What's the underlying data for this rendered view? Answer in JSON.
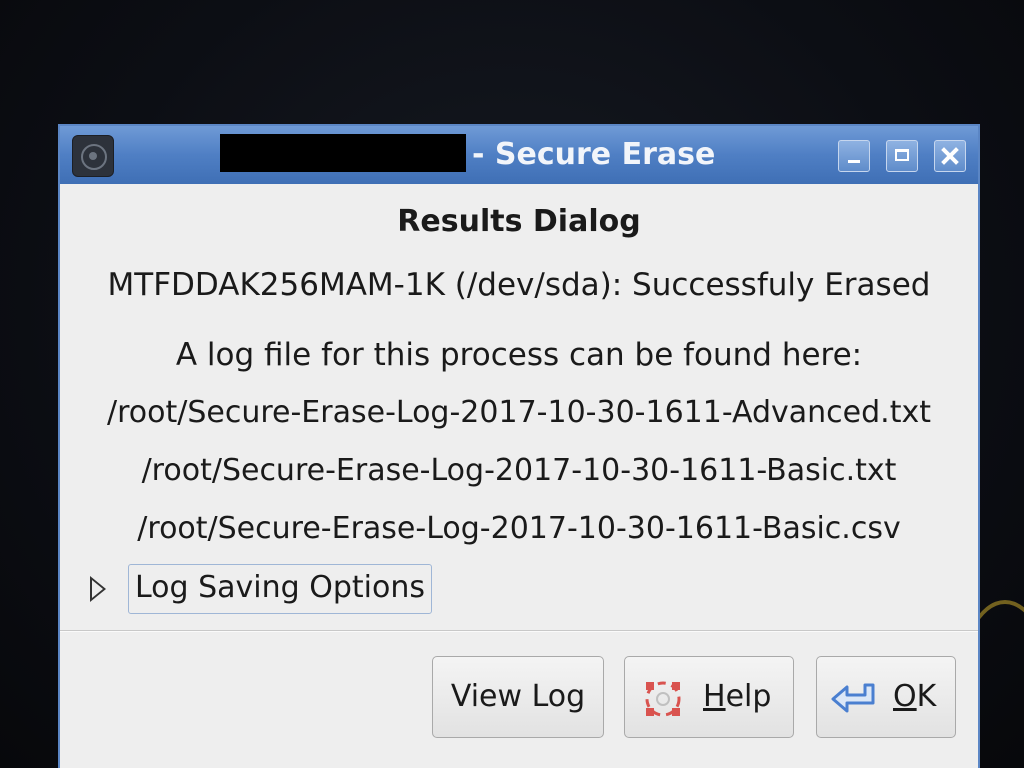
{
  "window": {
    "title_suffix": "- Secure Erase"
  },
  "dialog": {
    "heading": "Results Dialog",
    "status_line": "MTFDDAK256MAM-1K (/dev/sda): Successfuly Erased",
    "log_intro": "A log file for this process can be found here:",
    "log_paths": [
      "/root/Secure-Erase-Log-2017-10-30-1611-Advanced.txt",
      "/root/Secure-Erase-Log-2017-10-30-1611-Basic.txt",
      "/root/Secure-Erase-Log-2017-10-30-1611-Basic.csv"
    ],
    "expander_label": "Log Saving Options"
  },
  "buttons": {
    "view_log": "View Log",
    "help_mnemonic": "H",
    "help_rest": "elp",
    "ok_mnemonic": "O",
    "ok_rest": "K"
  },
  "icons": {
    "app": "app-icon",
    "minimize": "minimize-icon",
    "maximize": "maximize-icon",
    "close": "close-icon",
    "expander": "expander-arrow-icon",
    "help": "help-lifebuoy-icon",
    "ok": "ok-return-arrow-icon"
  },
  "colors": {
    "titlebar": "#4f7fc4",
    "window_bg": "#eeeeee",
    "help_icon": "#d9534f",
    "ok_icon": "#4a7fd0"
  }
}
